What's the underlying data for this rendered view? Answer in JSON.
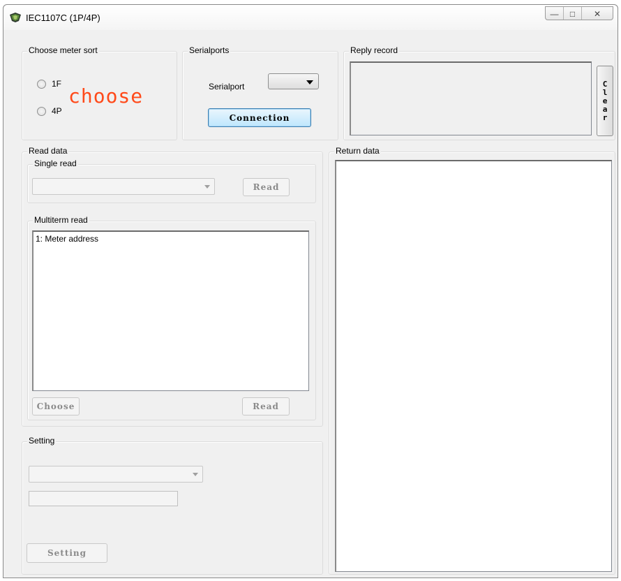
{
  "window": {
    "title": "IEC1107C (1P/4P)",
    "controls": {
      "minimize": "—",
      "maximize": "□",
      "close": "✕"
    }
  },
  "meter_sort": {
    "legend": "Choose meter sort",
    "options": [
      {
        "label": "1F",
        "checked": false
      },
      {
        "label": "4P",
        "checked": false
      }
    ],
    "hint_text": "choose"
  },
  "serialports": {
    "legend": "Serialports",
    "label": "Serialport",
    "selected": "",
    "connect_label": "Connection"
  },
  "reply_record": {
    "legend": "Reply record",
    "clear_label": [
      "C",
      "l",
      "e",
      "a",
      "r"
    ]
  },
  "read_data": {
    "legend": "Read data",
    "single_read": {
      "legend": "Single read",
      "selected": "",
      "read_label": "Read"
    },
    "multiterm_read": {
      "legend": "Multiterm read",
      "items": [
        "1: Meter address"
      ],
      "choose_label": "Choose",
      "read_label": "Read"
    }
  },
  "return_data": {
    "legend": "Return data"
  },
  "setting": {
    "legend": "Setting",
    "selected": "",
    "value": "",
    "button_label": "Setting"
  },
  "colors": {
    "hint_text": "#ff4a1a",
    "window_bg": "#f0f0f0",
    "focus_border": "#3c7fb1"
  }
}
